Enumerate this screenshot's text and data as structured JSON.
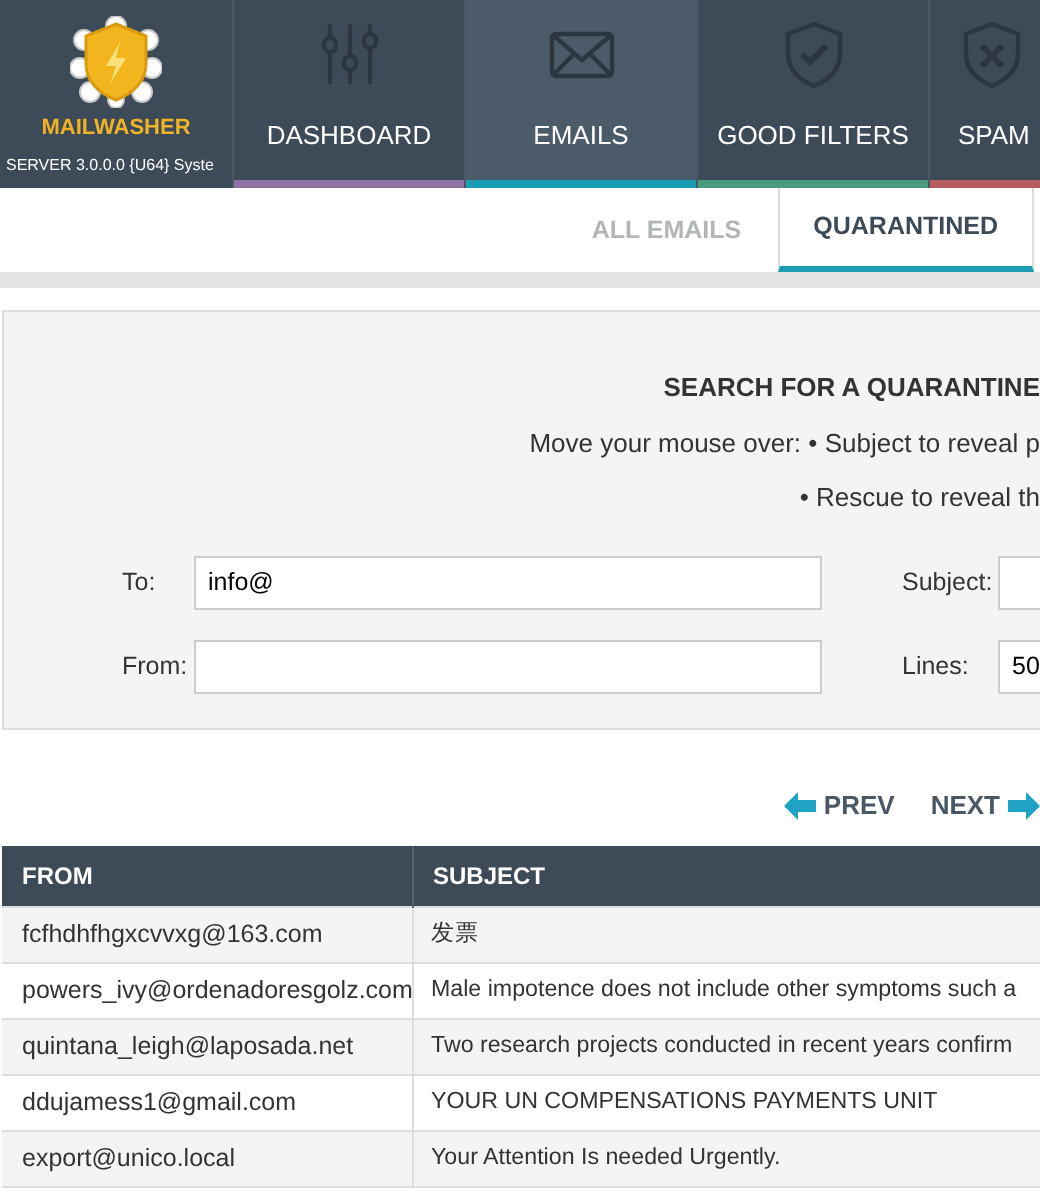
{
  "brand": {
    "name": "MAILWASHER",
    "subtitle": "SERVER 3.0.0.0 {U64} Syste"
  },
  "nav": [
    {
      "label": "DASHBOARD",
      "selected": false,
      "color": "#8e72a3"
    },
    {
      "label": "EMAILS",
      "selected": true,
      "color": "#1b9db3"
    },
    {
      "label": "GOOD FILTERS",
      "selected": false,
      "color": "#4a9a7e"
    },
    {
      "label": "SPAM",
      "selected": false,
      "color": "#b75d5f"
    }
  ],
  "subtabs": [
    {
      "label": "ALL EMAILS",
      "selected": false
    },
    {
      "label": "QUARANTINED",
      "selected": true
    }
  ],
  "search": {
    "title": "SEARCH FOR A QUARANTINE",
    "hint_lead": "Move your mouse over:",
    "hints": [
      "• Subject to reveal p",
      "• Rescue to reveal th"
    ],
    "fields": [
      {
        "label": "To:",
        "value": "info@"
      },
      {
        "label": "Subject:"
      },
      {
        "label": "From:"
      },
      {
        "label": "Lines:",
        "value": "50"
      }
    ]
  },
  "pager": {
    "prev": "PREV",
    "next": "NEXT"
  },
  "table": {
    "columns": [
      "FROM",
      "SUBJECT"
    ],
    "rows": [
      [
        "fcfhdhfhgxcvvxg@163.com",
        "发票"
      ],
      [
        "powers_ivy@ordenadoresgolz.com",
        "Male impotence does not include other symptoms such a"
      ],
      [
        "quintana_leigh@laposada.net",
        "Two research projects conducted in recent years confirm"
      ],
      [
        "ddujamess1@gmail.com",
        "YOUR UN COMPENSATIONS PAYMENTS UNIT"
      ],
      [
        "export@unico.local",
        "Your Attention Is needed Urgently."
      ]
    ]
  }
}
